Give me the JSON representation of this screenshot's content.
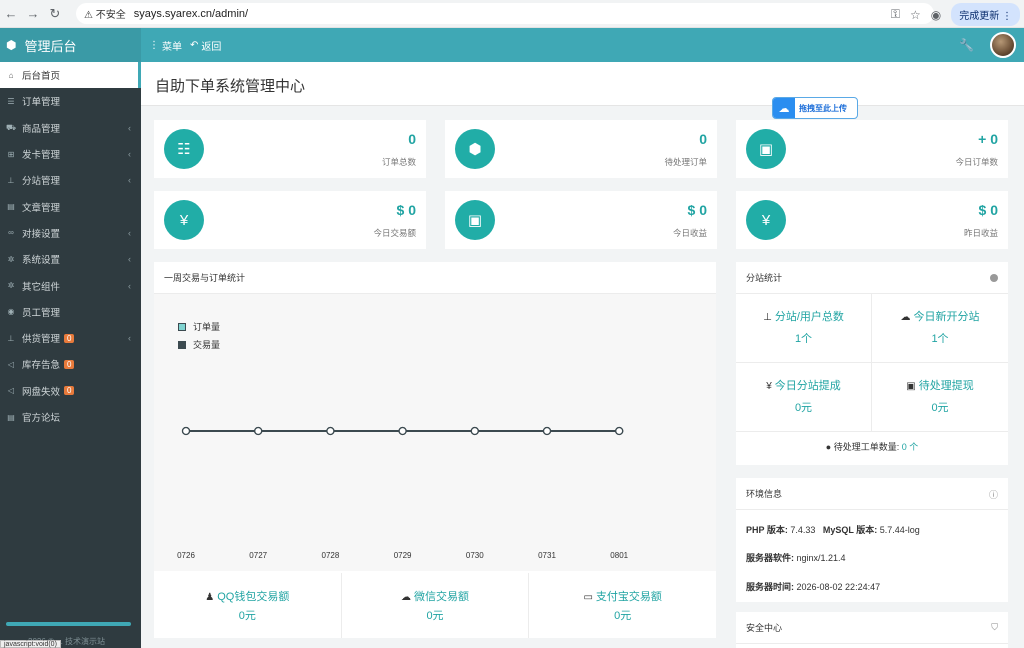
{
  "browser": {
    "warning": "不安全",
    "url": "syays.syarex.cn/admin/",
    "update_label": "完成更新"
  },
  "topbar": {
    "brand": "管理后台",
    "menu_label": "菜单",
    "back_label": "返回"
  },
  "sidebar": {
    "items": [
      {
        "label": "后台首页",
        "icon": "home-icon"
      },
      {
        "label": "订单管理",
        "icon": "list-icon"
      },
      {
        "label": "商品管理",
        "icon": "cart-icon"
      },
      {
        "label": "发卡管理",
        "icon": "grid-icon"
      },
      {
        "label": "分站管理",
        "icon": "sitemap-icon"
      },
      {
        "label": "文章管理",
        "icon": "book-icon"
      },
      {
        "label": "对接设置",
        "icon": "link-icon"
      },
      {
        "label": "系统设置",
        "icon": "gear-icon"
      },
      {
        "label": "其它组件",
        "icon": "gears-icon"
      },
      {
        "label": "员工管理",
        "icon": "user-icon"
      },
      {
        "label": "供货管理",
        "icon": "sitemap-icon",
        "badge": "0"
      },
      {
        "label": "库存告急",
        "icon": "bullhorn-icon",
        "badge": "0"
      },
      {
        "label": "网盘失效",
        "icon": "bullhorn-icon",
        "badge": "0"
      },
      {
        "label": "官方论坛",
        "icon": "book-icon"
      }
    ],
    "footer": "2026 © ... 技术演示站"
  },
  "status_url": "javascript:void(0)",
  "page": {
    "title": "自助下单系统管理中心",
    "drag_upload": "拖拽至此上传"
  },
  "stats": [
    {
      "value": "0",
      "label": "订单总数",
      "icon": "ordered-list-icon"
    },
    {
      "value": "0",
      "label": "待处理订单",
      "icon": "cube-icon"
    },
    {
      "value": "+ 0",
      "label": "今日订单数",
      "icon": "briefcase-icon"
    },
    {
      "value": "$ 0",
      "label": "今日交易额",
      "icon": "yen-icon"
    },
    {
      "value": "$ 0",
      "label": "今日收益",
      "icon": "briefcase-icon"
    },
    {
      "value": "$ 0",
      "label": "昨日收益",
      "icon": "yen-icon"
    }
  ],
  "chart_panel": {
    "title": "一周交易与订单统计"
  },
  "chart_data": {
    "type": "line",
    "categories": [
      "0726",
      "0727",
      "0728",
      "0729",
      "0730",
      "0731",
      "0801"
    ],
    "series": [
      {
        "name": "订单量",
        "values": [
          0,
          0,
          0,
          0,
          0,
          0,
          0
        ],
        "color": "#7fd3d0"
      },
      {
        "name": "交易量",
        "values": [
          0,
          0,
          0,
          0,
          0,
          0,
          0
        ],
        "color": "#3c4a50"
      }
    ]
  },
  "payments": [
    {
      "title": "QQ钱包交易额",
      "amount": "0元",
      "icon": "qq-icon"
    },
    {
      "title": "微信交易额",
      "amount": "0元",
      "icon": "wechat-icon"
    },
    {
      "title": "支付宝交易额",
      "amount": "0元",
      "icon": "credit-card-icon"
    }
  ],
  "substation": {
    "title": "分站统计",
    "cells": [
      {
        "title": "分站/用户总数",
        "value": "1个",
        "icon": "sitemap-icon"
      },
      {
        "title": "今日新开分站",
        "value": "1个",
        "icon": "cloud-icon"
      },
      {
        "title": "今日分站提成",
        "value": "0元",
        "icon": "yen-icon"
      },
      {
        "title": "待处理提现",
        "value": "0元",
        "icon": "money-icon"
      }
    ],
    "ticket_label": "待处理工单数量:",
    "ticket_value": "0 个"
  },
  "env": {
    "title": "环境信息",
    "php_label": "PHP 版本:",
    "php_value": "7.4.33",
    "mysql_label": "MySQL 版本:",
    "mysql_value": "5.7.44-log",
    "server_label": "服务器软件:",
    "server_value": "nginx/1.21.4",
    "time_label": "服务器时间:",
    "time_value": "2026-08-02 22:24:47"
  },
  "security": {
    "title": "安全中心"
  },
  "colors": {
    "accent": "#3fa8b5",
    "teal": "#21ada7",
    "sidebar": "#2f3b40"
  }
}
